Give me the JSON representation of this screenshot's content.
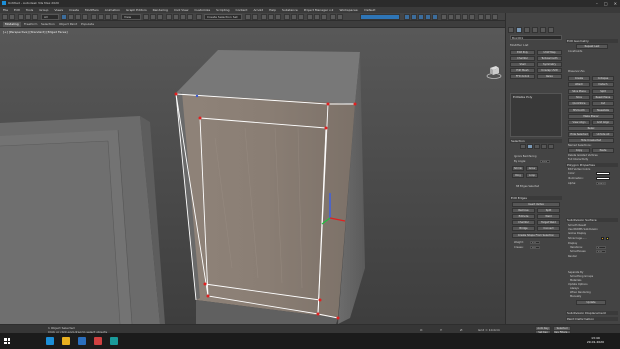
{
  "window": {
    "title": "Untitled - Autodesk 3ds Max 2020",
    "buttons": [
      "–",
      "□",
      "✕"
    ]
  },
  "menu": [
    "File",
    "Edit",
    "Tools",
    "Group",
    "Views",
    "Create",
    "Modifiers",
    "Animation",
    "Graph Editors",
    "Rendering",
    "Civil View",
    "Customize",
    "Scripting",
    "Content",
    "Arnold",
    "Help",
    "Substance",
    "Project Manager v.2",
    "Workspaces:",
    "Default"
  ],
  "toolbar": {
    "selection_filter": "All",
    "view_dropdown": "View",
    "named_selection": "Create Selection Set"
  },
  "ribbon_tabs": [
    "Modeling",
    "Freeform",
    "Selection",
    "Object Paint",
    "Populate"
  ],
  "viewport": {
    "label": "[+] [Perspective] [Standard] [Edged Faces]"
  },
  "command_panel": {
    "object_name": "Box001",
    "modifier_list_label": "Modifier List",
    "modifier_buttons": [
      "Edit Poly",
      "UVW Map",
      "Chamfer",
      "Turbosmooth",
      "Shell",
      "Symmetry",
      "Edit Mesh",
      "Unwrap UVW",
      "FFD 2x2x2",
      "Relax"
    ],
    "stack_item": "Editable Poly",
    "selection": {
      "header": "Selection",
      "ignore_backfacing": "Ignore Backfacing",
      "by_angle": "By Angle:",
      "by_angle_value": "45.0",
      "shrink": "Shrink",
      "grow": "Grow",
      "ring": "Ring",
      "loop": "Loop",
      "status": "88 Edges Selected"
    },
    "edit_edges": {
      "header": "Edit Edges",
      "buttons": [
        "Insert Vertex",
        "Remove",
        "Split",
        "Extrude",
        "Weld",
        "Chamfer",
        "Target Weld",
        "Bridge",
        "Connect",
        "Create Shape From Selection"
      ],
      "weight_label": "Weight:",
      "weight_value": "1.0",
      "crease_label": "Crease:",
      "crease_value": "0.0"
    },
    "edit_geometry": {
      "header": "Edit Geometry",
      "buttons": [
        "Repeat Last",
        "Create",
        "Collapse",
        "Attach",
        "Detach",
        "Slice Plane",
        "Split",
        "Slice",
        "Reset Plane",
        "QuickSlice",
        "Cut",
        "MSmooth",
        "Tessellate",
        "Make Planar",
        "View Align",
        "Grid Align",
        "Relax",
        "Hide Selected",
        "Unhide All",
        "Hide Unselected"
      ],
      "constraints_label": "Constraints",
      "preserve_uvs": "Preserve UVs",
      "named_selections": "Named Selections:",
      "copy": "Copy",
      "paste": "Paste",
      "delete_isolated": "Delete Isolated Vertices",
      "full_interactivity": "Full Interactivity"
    },
    "subdivision_surface": {
      "header": "Subdivision Surface",
      "smooth_result": "Smooth Result",
      "use_nurms": "Use NURMS Subdivision",
      "isoline_display": "Isoline Display",
      "show_cage": "Show Cage......",
      "display": "Display",
      "iterations_label": "Iterations:",
      "iterations_value": "1",
      "smoothness_label": "Smoothness:",
      "smoothness_value": "1.0",
      "render": "Render",
      "separate_by": "Separate By",
      "smoothing_groups": "Smoothing Groups",
      "materials": "Materials",
      "update_options": "Update Options",
      "always": "Always",
      "when_rendering": "When Rendering",
      "manually": "Manually",
      "update": "Update"
    },
    "subdivision_displacement": "Subdivision Displacement",
    "paint_deformation": "Paint Deformation",
    "polygon_properties": {
      "header": "Polygon Properties",
      "edit_vertex_colors": "Edit Vertex Colors",
      "color_label": "Color:",
      "illumination_label": "Illumination:",
      "alpha_label": "Alpha:",
      "alpha_value": "100.0"
    }
  },
  "status": {
    "selection": "1 Object Selected",
    "prompt": "Click or click-and-drag to select objects",
    "x_label": "X:",
    "x_value": "",
    "y_label": "Y:",
    "y_value": "",
    "z_label": "Z:",
    "z_value": "",
    "grid": "Grid = 10.0cm",
    "autokey": "Auto Key",
    "selected": "Selected",
    "setkey": "Set Key",
    "keyfilters": "Key Filters..."
  },
  "taskbar": {
    "time": "13:49",
    "date": "29.01.2020"
  },
  "colors": {
    "accent": "#2e75b6",
    "selection_edge": "#ffffff",
    "vertex": "#e02020",
    "background": "#4b4b4b"
  }
}
